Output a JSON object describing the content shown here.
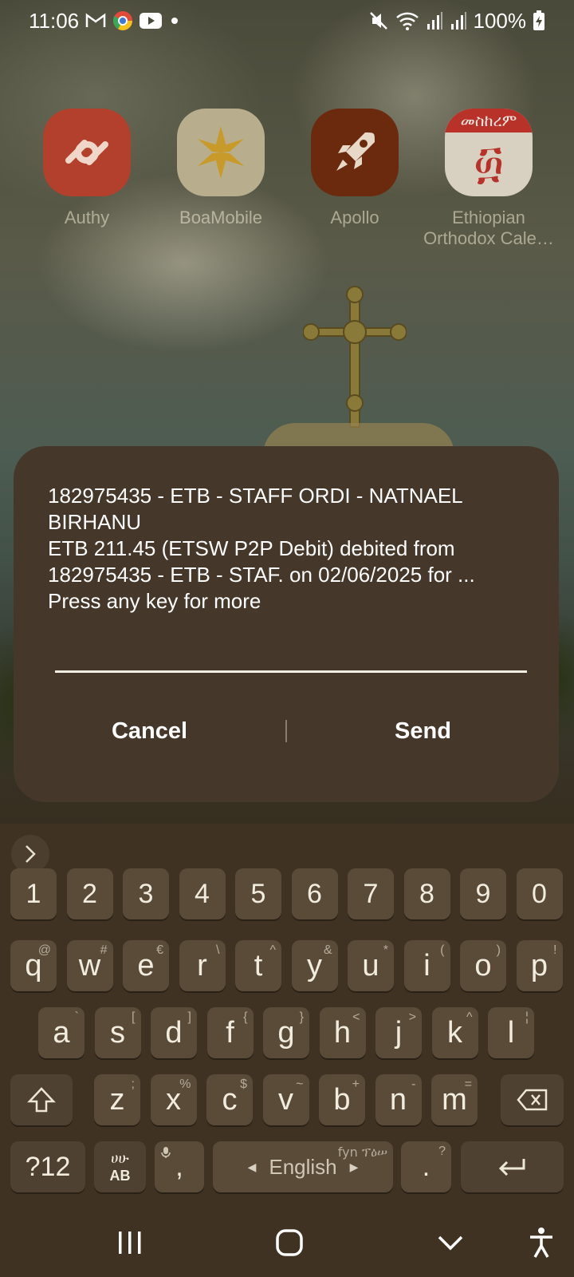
{
  "status_bar": {
    "time": "11:06",
    "battery": "100%",
    "left_icons": [
      "gmail-icon",
      "chrome-icon",
      "youtube-icon",
      "dot-icon"
    ],
    "right_icons": [
      "mute-icon",
      "wifi-icon",
      "signal-icon",
      "signal-icon",
      "battery-charging-icon"
    ]
  },
  "apps": [
    {
      "label": "Authy",
      "icon": "authy-icon",
      "color": "#c23a2a"
    },
    {
      "label": "BoaMobile",
      "icon": "boa-star-icon",
      "color": "#d8c9a3"
    },
    {
      "label": "Apollo",
      "icon": "rocket-icon",
      "color": "#7a2e10"
    },
    {
      "label": "Ethiopian\nOrthodox Cale…",
      "icon": "ethiopian-calendar-icon",
      "color": "#e8e0d0",
      "icon_text": "መስከረም",
      "glyph": "፴"
    }
  ],
  "dialog": {
    "message": "182975435 - ETB - STAFF ORDI - NATNAEL BIRHANU\nETB 211.45 (ETSW P2P Debit) debited from 182975435 - ETB - STAF. on 02/06/2025 for ...\nPress any key for more",
    "input_value": "",
    "cancel_label": "Cancel",
    "send_label": "Send"
  },
  "keyboard": {
    "number_row": [
      "1",
      "2",
      "3",
      "4",
      "5",
      "6",
      "7",
      "8",
      "9",
      "0"
    ],
    "row1": [
      [
        "q",
        "@"
      ],
      [
        "w",
        "#"
      ],
      [
        "e",
        "€"
      ],
      [
        "r",
        "\\"
      ],
      [
        "t",
        "^"
      ],
      [
        "y",
        "&"
      ],
      [
        "u",
        "*"
      ],
      [
        "i",
        "("
      ],
      [
        "o",
        ")"
      ],
      [
        "p",
        "!"
      ]
    ],
    "row2": [
      [
        "a",
        "`"
      ],
      [
        "s",
        "["
      ],
      [
        "d",
        "]"
      ],
      [
        "f",
        "{"
      ],
      [
        "g",
        "}"
      ],
      [
        "h",
        "<"
      ],
      [
        "j",
        ">"
      ],
      [
        "k",
        "^"
      ],
      [
        "l",
        "¦"
      ]
    ],
    "row3": [
      [
        "z",
        ";"
      ],
      [
        "x",
        "%"
      ],
      [
        "c",
        "$"
      ],
      [
        "v",
        "~"
      ],
      [
        "b",
        "+"
      ],
      [
        "n",
        "-"
      ],
      [
        "m",
        "="
      ]
    ],
    "symbols_label": "?12",
    "lang_switch_top": "ሀሁ",
    "lang_switch_bottom": "AB",
    "comma": ",",
    "space_label": "English",
    "space_hint": "fyn ፕዕሠ",
    "period": ".",
    "period_hint": "?"
  },
  "accent_colors": {
    "dialog_bg": "#45382a",
    "keyboard_bg": "#3f3223",
    "key_bg": "#5a4b39"
  }
}
